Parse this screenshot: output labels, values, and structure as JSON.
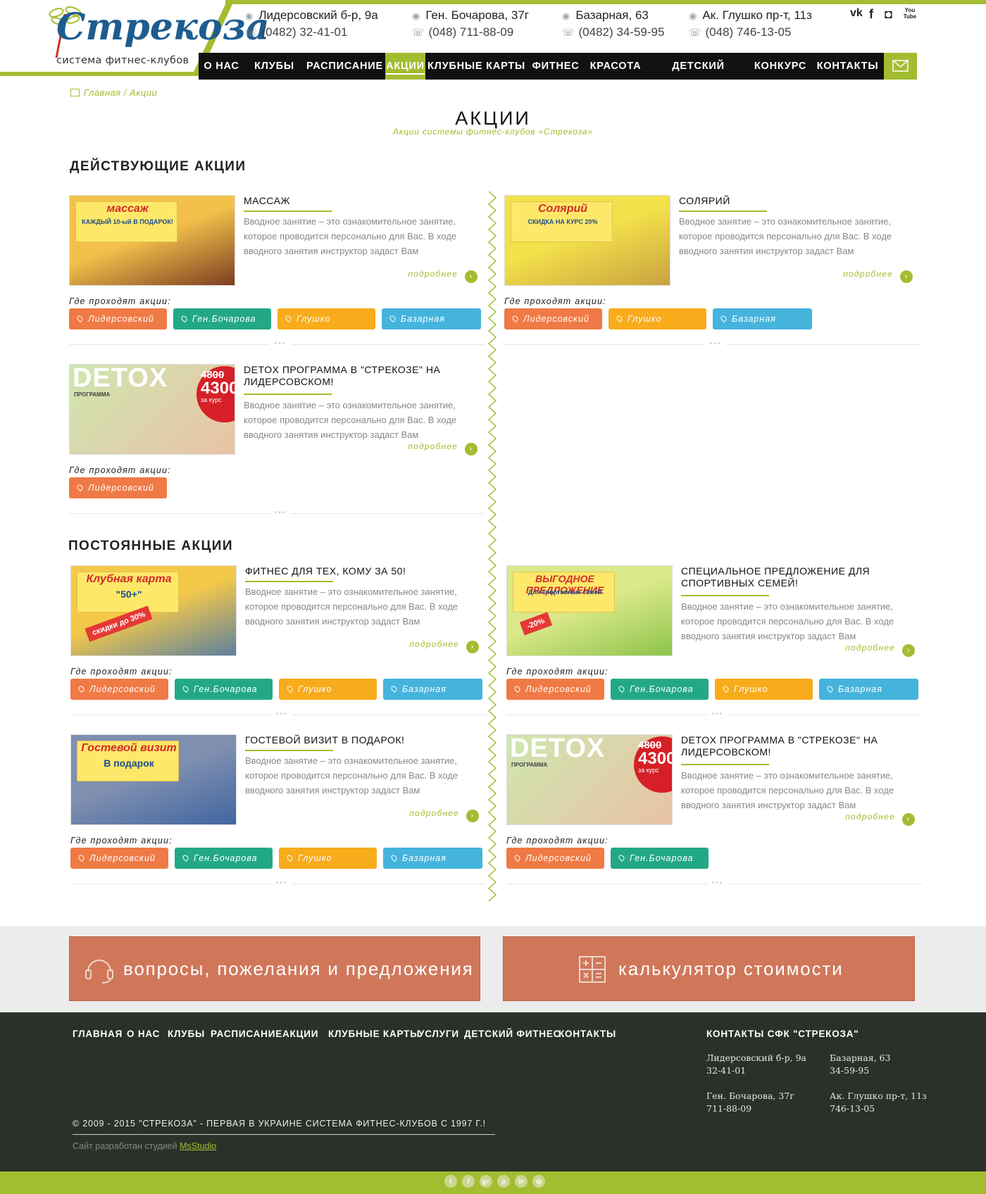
{
  "logo": {
    "title": "Стрекоза",
    "subtitle": "система фитнес-клубов"
  },
  "addresses": [
    {
      "street": "Лидерсовский б-р, 9а",
      "phone": "(0482) 32-41-01"
    },
    {
      "street": "Ген. Бочарова, 37г",
      "phone": "(048) 711-88-09"
    },
    {
      "street": "Базарная, 63",
      "phone": "(0482) 34-59-95"
    },
    {
      "street": "Ак. Глушко пр-т, 11з",
      "phone": "(048) 746-13-05"
    }
  ],
  "social_top": [
    "vk-icon",
    "facebook-icon",
    "instagram-icon",
    "youtube-icon"
  ],
  "social_top_text": {
    "vk": "vk",
    "fb": "f",
    "ig": "◘",
    "yt": "You Tube"
  },
  "nav": [
    "О НАС",
    "КЛУБЫ",
    "РАСПИСАНИЕ",
    "АКЦИИ",
    "КЛУБНЫЕ КАРТЫ",
    "ФИТНЕС",
    "КРАСОТА",
    "ДЕТСКИЙ ФИТНЕС",
    "КОНКУРС",
    "КОНТАКТЫ"
  ],
  "nav_active": "АКЦИИ",
  "breadcrumb": {
    "home": "Главная",
    "sep": "/",
    "current": "Акции"
  },
  "page": {
    "title": "АКЦИИ",
    "subtitle": "Акции системы фитнес-клубов «Стрекоза»"
  },
  "sections": {
    "current": "ДЕЙСТВУЮЩИЕ АКЦИИ",
    "permanent": "ПОСТОЯННЫЕ АКЦИИ"
  },
  "where_label": "Где проходят акции:",
  "more_label": "подробнее",
  "desc_common": "Вводное занятие – это ознакомительное занятие, которое проводится персонально для Вас. В ходе вводного занятия инструктор задаст Вам",
  "cards": [
    {
      "title": "МАССАЖ",
      "img_top": "массаж",
      "img_bottom": "КАЖДЫЙ 10-ый В ПОДАРОК!",
      "tags": [
        "Лидерсовский",
        "Ген.Бочарова",
        "Глушко",
        "Базарная"
      ]
    },
    {
      "title": "СОЛЯРИЙ",
      "img_top": "Солярий",
      "img_bottom": "СКИДКА НА КУРС 20%",
      "tags": [
        "Лидерсовский",
        "Глушко",
        "Базарная"
      ]
    },
    {
      "title": "DETOX ПРОГРАММА В \"СТРЕКОЗЕ\" НА ЛИДЕРСОВСКОМ!",
      "img_top": "DETOX",
      "img_bottom": "ПРОГРАММА",
      "price_old": "4800",
      "price_new": "4300",
      "price_note": "за курс",
      "tags": [
        "Лидерсовский"
      ]
    },
    {
      "title": "ФИТНЕС ДЛЯ ТЕХ, КОМУ ЗА 50!",
      "img_top": "Клубная карта",
      "img_bottom": "\"50+\"",
      "badge": "скидки до 30%",
      "tags": [
        "Лидерсовский",
        "Ген.Бочарова",
        "Глушко",
        "Базарная"
      ]
    },
    {
      "title": "СПЕЦИАЛЬНОЕ ПРЕДЛОЖЕНИЕ ДЛЯ СПОРТИВНЫХ СЕМЕЙ!",
      "img_top": "ВЫГОДНОЕ ПРЕДЛОЖЕНИЕ",
      "img_bottom": "Для спортивных семей",
      "badge": "-20%",
      "tags": [
        "Лидерсовский",
        "Ген.Бочарова",
        "Глушко",
        "Базарная"
      ]
    },
    {
      "title": "ГОСТЕВОЙ ВИЗИТ В ПОДАРОК!",
      "img_top": "Гостевой визит",
      "img_bottom": "В подарок",
      "tags": [
        "Лидерсовский",
        "Ген.Бочарова",
        "Глушко",
        "Базарная"
      ]
    },
    {
      "title": "DETOX ПРОГРАММА В \"СТРЕКОЗЕ\" НА ЛИДЕРСОВСКОМ!",
      "img_top": "DETOX",
      "img_bottom": "ПРОГРАММА",
      "price_old": "4800",
      "price_new": "4300",
      "price_note": "за курс",
      "tags": [
        "Лидерсовский",
        "Ген.Бочарова"
      ]
    }
  ],
  "tag_colors": {
    "Лидерсовский": "#f07a45",
    "Ген.Бочарова": "#23a887",
    "Глушко": "#f8ab1b",
    "Базарная": "#45b4dd"
  },
  "accent": "#a3bd31",
  "feedback_button": "вопросы, пожелания и предложения",
  "calc_button": "калькулятор стоимости",
  "footer_nav": [
    "ГЛАВНАЯ",
    "О НАС",
    "КЛУБЫ",
    "РАСПИСАНИЕ",
    "АКЦИИ",
    "КЛУБНЫЕ КАРТЫ",
    "УСЛУГИ",
    "ДЕТСКИЙ ФИТНЕС",
    "КОНТАКТЫ"
  ],
  "footer_contacts": {
    "heading": "КОНТАКТЫ  СФК \"СТРЕКОЗА\"",
    "items": [
      {
        "street": "Лидерсовский б-р, 9а",
        "phone": "32-41-01"
      },
      {
        "street": "Базарная, 63",
        "phone": "34-59-95"
      },
      {
        "street": "Ген. Бочарова, 37г",
        "phone": "711-88-09"
      },
      {
        "street": "Ак. Глушко пр-т, 11з",
        "phone": "746-13-05"
      }
    ]
  },
  "copyright": "© 2009 - 2015 \"СТРЕКОЗА\" - ПЕРВАЯ В УКРАИНЕ СИСТЕМА ФИТНЕС-КЛУБОВ С 1997 Г.!",
  "developer": {
    "prefix": "Сайт разработан студией ",
    "name": "MsStudio"
  },
  "footer_social": [
    "twitter-icon",
    "facebook-icon",
    "google-plus-icon",
    "pinterest-icon",
    "linkedin-icon",
    "dribbble-icon"
  ]
}
